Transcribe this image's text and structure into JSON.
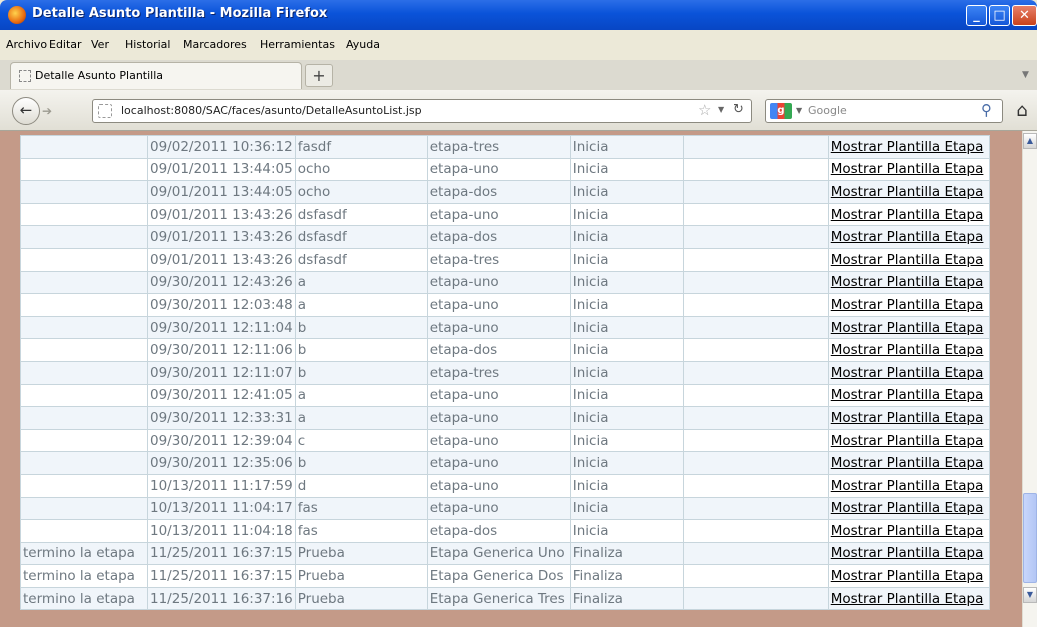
{
  "window": {
    "title": "Detalle Asunto Plantilla - Mozilla Firefox"
  },
  "menu": [
    "Archivo",
    "Editar",
    "Ver",
    "Historial",
    "Marcadores",
    "Herramientas",
    "Ayuda"
  ],
  "tab": {
    "label": "Detalle Asunto Plantilla",
    "new_tab": "+"
  },
  "nav": {
    "url": "localhost:8080/SAC/faces/asunto/DetalleAsuntoList.jsp",
    "search_placeholder": "Google"
  },
  "rows": [
    [
      "",
      "09/02/2011 10:36:12",
      "fasdf",
      "etapa-tres",
      "Inicia",
      "",
      "Mostrar Plantilla Etapa"
    ],
    [
      "",
      "09/01/2011 13:44:05",
      "ocho",
      "etapa-uno",
      "Inicia",
      "",
      "Mostrar Plantilla Etapa"
    ],
    [
      "",
      "09/01/2011 13:44:05",
      "ocho",
      "etapa-dos",
      "Inicia",
      "",
      "Mostrar Plantilla Etapa"
    ],
    [
      "",
      "09/01/2011 13:43:26",
      "dsfasdf",
      "etapa-uno",
      "Inicia",
      "",
      "Mostrar Plantilla Etapa"
    ],
    [
      "",
      "09/01/2011 13:43:26",
      "dsfasdf",
      "etapa-dos",
      "Inicia",
      "",
      "Mostrar Plantilla Etapa"
    ],
    [
      "",
      "09/01/2011 13:43:26",
      "dsfasdf",
      "etapa-tres",
      "Inicia",
      "",
      "Mostrar Plantilla Etapa"
    ],
    [
      "",
      "09/30/2011 12:43:26",
      "a",
      "etapa-uno",
      "Inicia",
      "",
      "Mostrar Plantilla Etapa"
    ],
    [
      "",
      "09/30/2011 12:03:48",
      "a",
      "etapa-uno",
      "Inicia",
      "",
      "Mostrar Plantilla Etapa"
    ],
    [
      "",
      "09/30/2011 12:11:04",
      "b",
      "etapa-uno",
      "Inicia",
      "",
      "Mostrar Plantilla Etapa"
    ],
    [
      "",
      "09/30/2011 12:11:06",
      "b",
      "etapa-dos",
      "Inicia",
      "",
      "Mostrar Plantilla Etapa"
    ],
    [
      "",
      "09/30/2011 12:11:07",
      "b",
      "etapa-tres",
      "Inicia",
      "",
      "Mostrar Plantilla Etapa"
    ],
    [
      "",
      "09/30/2011 12:41:05",
      "a",
      "etapa-uno",
      "Inicia",
      "",
      "Mostrar Plantilla Etapa"
    ],
    [
      "",
      "09/30/2011 12:33:31",
      "a",
      "etapa-uno",
      "Inicia",
      "",
      "Mostrar Plantilla Etapa"
    ],
    [
      "",
      "09/30/2011 12:39:04",
      "c",
      "etapa-uno",
      "Inicia",
      "",
      "Mostrar Plantilla Etapa"
    ],
    [
      "",
      "09/30/2011 12:35:06",
      "b",
      "etapa-uno",
      "Inicia",
      "",
      "Mostrar Plantilla Etapa"
    ],
    [
      "",
      "10/13/2011 11:17:59",
      "d",
      "etapa-uno",
      "Inicia",
      "",
      "Mostrar Plantilla Etapa"
    ],
    [
      "",
      "10/13/2011 11:04:17",
      "fas",
      "etapa-uno",
      "Inicia",
      "",
      "Mostrar Plantilla Etapa"
    ],
    [
      "",
      "10/13/2011 11:04:18",
      "fas",
      "etapa-dos",
      "Inicia",
      "",
      "Mostrar Plantilla Etapa"
    ],
    [
      "termino la etapa",
      "11/25/2011 16:37:15",
      "Prueba",
      "Etapa Generica Uno",
      "Finaliza",
      "",
      "Mostrar Plantilla Etapa"
    ],
    [
      "termino la etapa",
      "11/25/2011 16:37:15",
      "Prueba",
      "Etapa Generica Dos",
      "Finaliza",
      "",
      "Mostrar Plantilla Etapa"
    ],
    [
      "termino la etapa",
      "11/25/2011 16:37:16",
      "Prueba",
      "Etapa Generica Tres",
      "Finaliza",
      "",
      "Mostrar Plantilla Etapa"
    ]
  ]
}
